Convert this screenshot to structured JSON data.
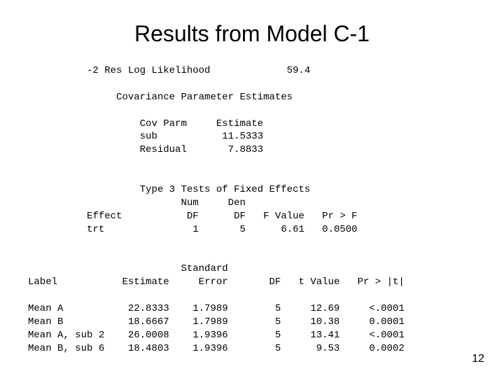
{
  "title": "Results from Model C-1",
  "fit_stat_label": "-2 Res Log Likelihood",
  "fit_stat_value": "59.4",
  "cov_section_title": "Covariance Parameter Estimates",
  "cov_header_parm": "Cov Parm",
  "cov_header_est": "Estimate",
  "cov_rows": {
    "r1_parm": "sub",
    "r1_est": "11.5333",
    "r2_parm": "Residual",
    "r2_est": "7.8833"
  },
  "type3_title": "Type 3 Tests of Fixed Effects",
  "type3_headers": {
    "numdf_top": "Num",
    "dendf_top": "Den",
    "effect": "Effect",
    "numdf": "DF",
    "dendf": "DF",
    "fval": "F Value",
    "prf": "Pr > F"
  },
  "type3_row": {
    "effect": "trt",
    "numdf": "1",
    "dendf": "5",
    "fval": "6.61",
    "prf": "0.0500"
  },
  "lsm_headers": {
    "label": "Label",
    "estimate": "Estimate",
    "stderr_top": "Standard",
    "stderr": "Error",
    "df": "DF",
    "tval": "t Value",
    "prt": "Pr > |t|"
  },
  "lsm_rows": {
    "r1_label": "Mean A",
    "r1_est": "22.8333",
    "r1_se": "1.7989",
    "r1_df": "5",
    "r1_t": "12.69",
    "r1_p": "<.0001",
    "r2_label": "Mean B",
    "r2_est": "18.6667",
    "r2_se": "1.7989",
    "r2_df": "5",
    "r2_t": "10.38",
    "r2_p": "0.0001",
    "r3_label": "Mean A, sub 2",
    "r3_est": "26.0008",
    "r3_se": "1.9396",
    "r3_df": "5",
    "r3_t": "13.41",
    "r3_p": "<.0001",
    "r4_label": "Mean B, sub 6",
    "r4_est": "18.4803",
    "r4_se": "1.9396",
    "r4_df": "5",
    "r4_t": "9.53",
    "r4_p": "0.0002"
  },
  "page_number": "12"
}
